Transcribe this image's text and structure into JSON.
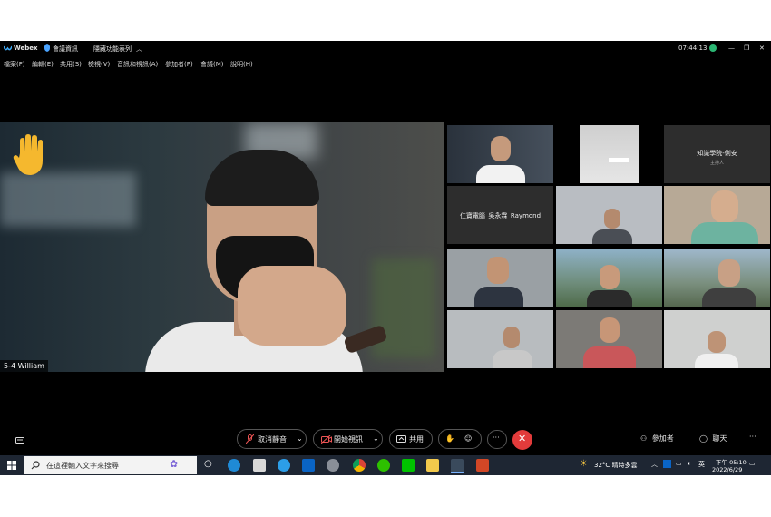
{
  "titlebar": {
    "app": "Webex",
    "meeting_info": "會議資訊",
    "hide_menu": "隱藏功能表列",
    "time": "07:44:13"
  },
  "menu": [
    "檔案(F)",
    "編輯(E)",
    "共用(S)",
    "檢視(V)",
    "音訊和視訊(A)",
    "參加者(P)",
    "會議(M)",
    "說明(H)"
  ],
  "main_video": {
    "name": "5-4 William"
  },
  "tiles": [
    {
      "label": "",
      "sub": ""
    },
    {
      "label": "",
      "sub": ""
    },
    {
      "label": "知識學院-俐安",
      "sub": "主持人"
    },
    {
      "label": "仁寶電腦_吳永霖_Raymond",
      "sub": ""
    }
  ],
  "controls": {
    "mute": "取消靜音",
    "video": "開始視訊",
    "share": "共用",
    "participants": "參加者",
    "chat": "聊天"
  },
  "taskbar": {
    "search": "在這裡輸入文字來搜尋",
    "weather": "32°C  晴時多雲",
    "lang": "英",
    "time": "下午 05:10",
    "date": "2022/6/29"
  },
  "colors": {
    "end_call": "#e23b3b",
    "raised_hand": "#f5b82e"
  }
}
